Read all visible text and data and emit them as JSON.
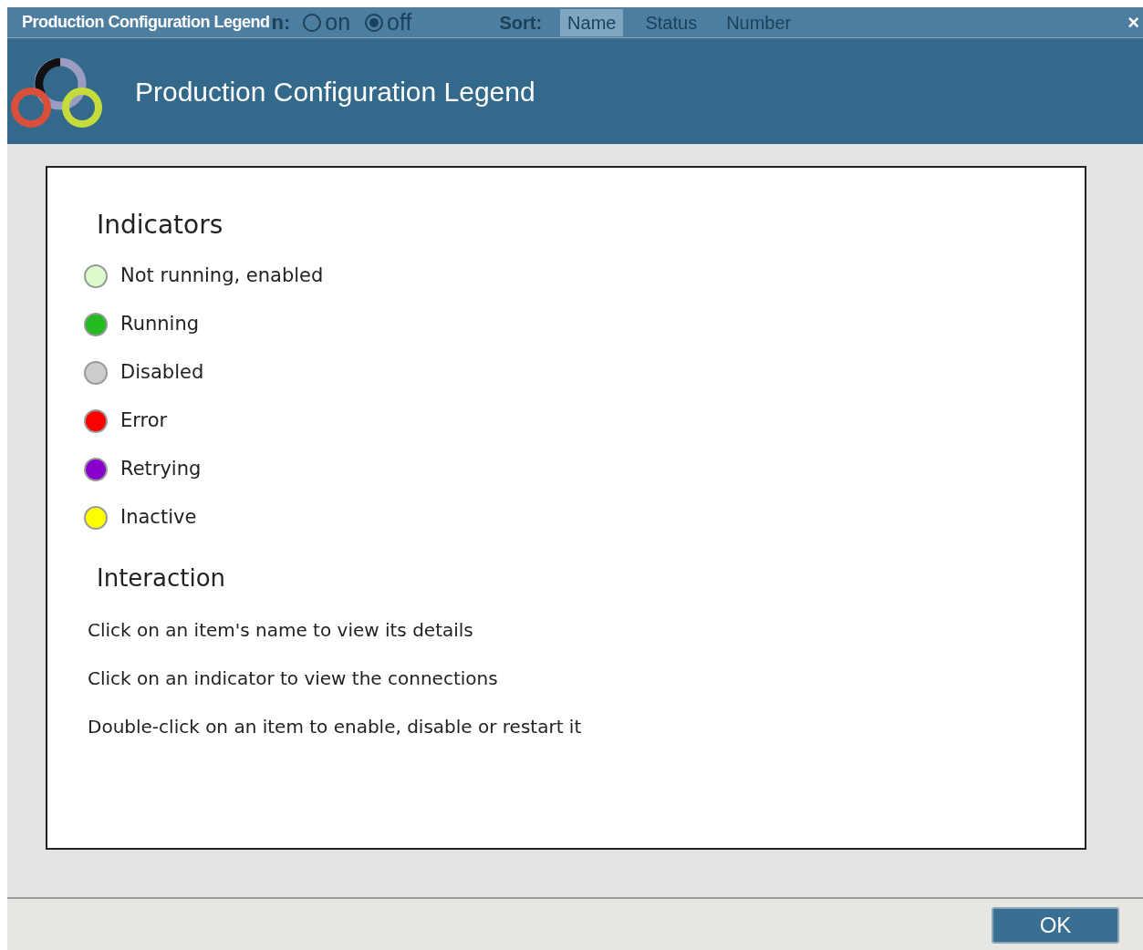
{
  "window": {
    "title": "Production Configuration Legend",
    "close": "×"
  },
  "behind_toolbar": {
    "label_end": "n:",
    "radios": [
      {
        "label": "on",
        "selected": false
      },
      {
        "label": "off",
        "selected": true
      }
    ],
    "sort_label": "Sort:",
    "sort_options": [
      {
        "label": "Name",
        "selected": true
      },
      {
        "label": "Status",
        "selected": false
      },
      {
        "label": "Number",
        "selected": false
      }
    ]
  },
  "header": {
    "title": "Production Configuration Legend"
  },
  "indicators": {
    "heading": "Indicators",
    "items": [
      {
        "label": "Not running, enabled",
        "color": "#ddfccc"
      },
      {
        "label": "Running",
        "color": "#22bb22"
      },
      {
        "label": "Disabled",
        "color": "#cccccc"
      },
      {
        "label": "Error",
        "color": "#ff0000"
      },
      {
        "label": "Retrying",
        "color": "#8800cc"
      },
      {
        "label": "Inactive",
        "color": "#ffff00"
      }
    ]
  },
  "interaction": {
    "heading": "Interaction",
    "lines": [
      "Click on an item's name to view its details",
      "Click on an indicator to view the connections",
      "Double-click on an item to enable, disable or restart it"
    ]
  },
  "buttons": [
    "OK"
  ]
}
